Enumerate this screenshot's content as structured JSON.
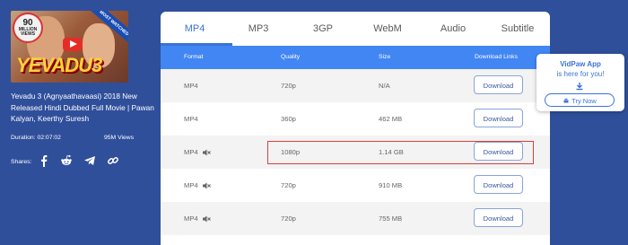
{
  "video": {
    "thumbnail": {
      "views_badge_number": "90",
      "views_badge_text": "MILLION VIEWS",
      "ribbon": "MOST WATCHED",
      "logo": "YEVADU3"
    },
    "title": "Yevadu 3 (Agnyaathavaasi) 2018 New Released Hindi Dubbed Full Movie | Pawan Kalyan, Keerthy Suresh",
    "duration": "Duration: 02:07:02",
    "views": "95M Views",
    "shares_label": "Shares:",
    "share_icons": [
      "facebook-icon",
      "reddit-icon",
      "telegram-icon",
      "link-icon"
    ]
  },
  "tabs": [
    {
      "label": "MP4",
      "active": true
    },
    {
      "label": "MP3",
      "active": false
    },
    {
      "label": "3GP",
      "active": false
    },
    {
      "label": "WebM",
      "active": false
    },
    {
      "label": "Audio",
      "active": false
    },
    {
      "label": "Subtitle",
      "active": false
    }
  ],
  "table": {
    "headers": {
      "format": "Format",
      "quality": "Quality",
      "size": "Size",
      "links": "Download Links"
    },
    "rows": [
      {
        "format": "MP4",
        "muted": false,
        "quality": "720p",
        "size": "N/A",
        "button": "Download"
      },
      {
        "format": "MP4",
        "muted": false,
        "quality": "360p",
        "size": "462 MB",
        "button": "Download"
      },
      {
        "format": "MP4",
        "muted": true,
        "quality": "1080p",
        "size": "1.14 GB",
        "button": "Download"
      },
      {
        "format": "MP4",
        "muted": true,
        "quality": "720p",
        "size": "910 MB",
        "button": "Download"
      },
      {
        "format": "MP4",
        "muted": true,
        "quality": "720p",
        "size": "755 MB",
        "button": "Download"
      }
    ]
  },
  "app_popup": {
    "title": "VidPaw App",
    "subtitle": "is here for you!",
    "button": "Try Now"
  },
  "colors": {
    "page_bg": "#2f4f9b",
    "accent": "#3b73d6",
    "header_bg": "#4286f4",
    "highlight": "#e23b3b"
  }
}
